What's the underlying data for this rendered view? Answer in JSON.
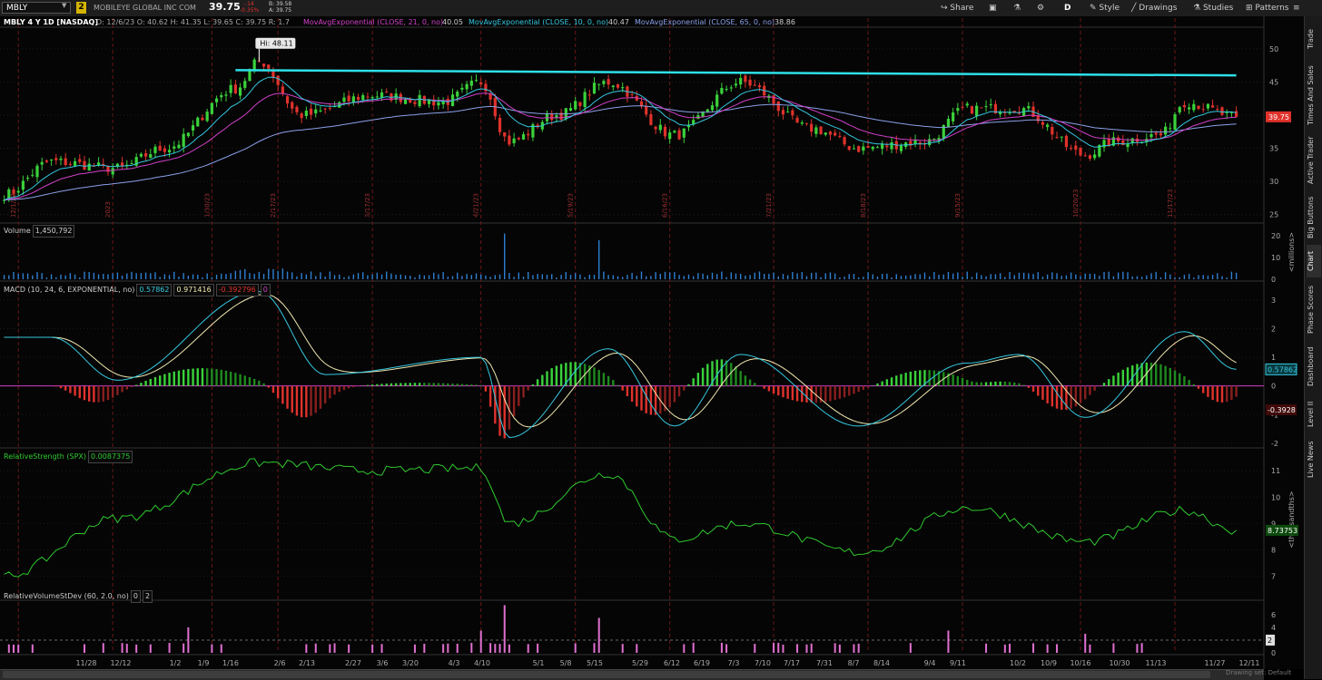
{
  "toolbar": {
    "symbol": "MBLY",
    "link_badge": "2",
    "company": "MOBILEYE GLOBAL INC COM",
    "last_price": "39.75",
    "change": "-.14",
    "change_pct": "-0.35%",
    "bid": "B: 39.58",
    "ask": "A: 39.75",
    "buttons": [
      "Share",
      "D",
      "Style",
      "Drawings",
      "Studies",
      "Patterns"
    ]
  },
  "status": {
    "title": "MBLY 4 Y 1D [NASDAQ]",
    "ohlc": "D: 12/6/23   O: 40.62   H: 41.35   L: 39.65   C: 39.75   R: 1.7",
    "ma1_label": "MovAvgExponential (CLOSE, 21, 0, no)",
    "ma1_value": "40.05",
    "ma2_label": "MovAvgExponential (CLOSE, 10, 0, no)",
    "ma2_value": "40.47",
    "ma3_label": "MovAvgExponential (CLOSE, 65, 0, no)",
    "ma3_value": "38.86"
  },
  "sidebar_tabs": [
    "Trade",
    "Times And Sales",
    "Active Trader",
    "Big Buttons",
    "Chart",
    "Phase Scores",
    "Dashboard",
    "Level II",
    "Live News"
  ],
  "colors": {
    "up": "#3ad23a",
    "down": "#e0322c",
    "ema21": "#d040c8",
    "ema10": "#35c8e0",
    "ema65": "#8aa0e8",
    "resistance": "#2ee0e8",
    "macd": "#35c8e0",
    "signal": "#f0e8b0",
    "rs": "#2fc82f",
    "rvol": "#e070d0"
  },
  "price_pane": {
    "y_ticks": [
      "50",
      "45",
      "40",
      "35",
      "30",
      "25"
    ],
    "high_label": "Hi: 48.11",
    "price_badge": "39.75",
    "month_markers": [
      "12/1/22",
      "2023",
      "1/30/23",
      "2/17/23",
      "3/17/23",
      "4/21/23",
      "5/19/23",
      "6/16/23",
      "7/21/23",
      "8/18/23",
      "9/15/23",
      "10/20/23",
      "11/17/23",
      "12/22/23"
    ]
  },
  "volume_pane": {
    "label": "Volume",
    "value": "1,450,792",
    "y_ticks": [
      "20",
      "10",
      "0"
    ],
    "unit": "<millions>"
  },
  "macd_pane": {
    "label": "MACD (10, 24, 6, EXPONENTIAL, no)",
    "macd_value": "0.57862",
    "signal_value": "0.971416",
    "hist_value": "-0.392796",
    "zero_value": "0",
    "y_ticks": [
      "3",
      "2",
      "1",
      "0",
      "-1",
      "-2"
    ],
    "badge_macd": "0.57862",
    "badge_hist": "-0.3928"
  },
  "rs_pane": {
    "label": "RelativeStrength (SPX)",
    "value": "0.0087375",
    "y_ticks": [
      "11",
      "10",
      "9",
      "8",
      "7"
    ],
    "unit": "<thousandths>",
    "badge": "8.73753"
  },
  "rvol_pane": {
    "label": "RelativeVolumeStDev (60, 2.0, no)",
    "value1": "0",
    "value2": "2",
    "y_ticks": [
      "6",
      "4",
      "2",
      "0"
    ],
    "badge": "2"
  },
  "x_axis": {
    "labels": [
      "11/28",
      "12/12",
      "1/2",
      "1/9",
      "1/16",
      "2/6",
      "2/13",
      "2/27",
      "3/6",
      "3/20",
      "4/3",
      "4/10",
      "5/1",
      "5/8",
      "5/15",
      "5/29",
      "6/12",
      "6/19",
      "7/3",
      "7/10",
      "7/17",
      "7/31",
      "8/7",
      "8/14",
      "9/4",
      "9/11",
      "10/2",
      "10/9",
      "10/16",
      "10/30",
      "11/13",
      "11/27",
      "12/11"
    ],
    "footer_text": "Drawing set: Default"
  },
  "chart_data": {
    "type": "candlestick",
    "symbol": "MBLY",
    "period": "1D",
    "price_key_points": [
      {
        "date": "11/28",
        "close": 28
      },
      {
        "date": "12/12",
        "close": 33
      },
      {
        "date": "1/2",
        "close": 32
      },
      {
        "date": "1/16",
        "close": 35
      },
      {
        "date": "2/6",
        "close": 44
      },
      {
        "date": "2/13",
        "close": 48.11
      },
      {
        "date": "2/27",
        "close": 40
      },
      {
        "date": "3/20",
        "close": 43
      },
      {
        "date": "4/10",
        "close": 42
      },
      {
        "date": "4/21",
        "close": 45
      },
      {
        "date": "5/1",
        "close": 36
      },
      {
        "date": "5/15",
        "close": 40
      },
      {
        "date": "5/29",
        "close": 45
      },
      {
        "date": "6/19",
        "close": 37
      },
      {
        "date": "7/10",
        "close": 45
      },
      {
        "date": "7/31",
        "close": 38
      },
      {
        "date": "8/14",
        "close": 35
      },
      {
        "date": "9/4",
        "close": 36
      },
      {
        "date": "9/15",
        "close": 41
      },
      {
        "date": "10/2",
        "close": 41
      },
      {
        "date": "10/20",
        "close": 34
      },
      {
        "date": "10/30",
        "close": 36
      },
      {
        "date": "11/13",
        "close": 37
      },
      {
        "date": "11/20",
        "close": 42
      },
      {
        "date": "12/6",
        "close": 39.75
      }
    ],
    "resistance_line": {
      "from_date": "2/6",
      "to_date": "12/6",
      "from_price": 46.8,
      "to_price": 46.0
    },
    "ylim": [
      24,
      53
    ],
    "last": {
      "open": 40.62,
      "high": 41.35,
      "low": 39.65,
      "close": 39.75
    },
    "ema_last": {
      "ema21": 40.05,
      "ema10": 40.47,
      "ema65": 38.86
    },
    "volume_spikes_millions": [
      {
        "date": "4/28",
        "value": 21
      },
      {
        "date": "5/26",
        "value": 18
      }
    ],
    "macd_key_points": [
      {
        "date": "12/12",
        "macd": 1.7
      },
      {
        "date": "1/2",
        "macd": 0.2
      },
      {
        "date": "2/13",
        "macd": 3.3
      },
      {
        "date": "3/6",
        "macd": 0.4
      },
      {
        "date": "4/21",
        "macd": 1.0
      },
      {
        "date": "5/1",
        "macd": -1.8
      },
      {
        "date": "5/29",
        "macd": 1.3
      },
      {
        "date": "6/19",
        "macd": -1.4
      },
      {
        "date": "7/10",
        "macd": 1.1
      },
      {
        "date": "8/14",
        "macd": -1.4
      },
      {
        "date": "9/15",
        "macd": 0.8
      },
      {
        "date": "10/2",
        "macd": 1.1
      },
      {
        "date": "10/20",
        "macd": -1.1
      },
      {
        "date": "11/20",
        "macd": 1.9
      },
      {
        "date": "12/6",
        "macd": 0.58
      }
    ],
    "rs_key_points": [
      {
        "date": "11/28",
        "rs": 7.0
      },
      {
        "date": "1/2",
        "rs": 9.2
      },
      {
        "date": "2/13",
        "rs": 11.3
      },
      {
        "date": "3/20",
        "rs": 11.0
      },
      {
        "date": "4/21",
        "rs": 11.1
      },
      {
        "date": "5/1",
        "rs": 9.0
      },
      {
        "date": "5/29",
        "rs": 10.9
      },
      {
        "date": "6/19",
        "rs": 8.4
      },
      {
        "date": "7/10",
        "rs": 9.0
      },
      {
        "date": "8/14",
        "rs": 7.9
      },
      {
        "date": "9/15",
        "rs": 9.6
      },
      {
        "date": "10/20",
        "rs": 8.3
      },
      {
        "date": "11/20",
        "rs": 9.5
      },
      {
        "date": "12/6",
        "rs": 8.74
      }
    ],
    "rvol_spikes": [
      {
        "date": "1/23",
        "value": 4
      },
      {
        "date": "4/21",
        "value": 3.5
      },
      {
        "date": "4/28",
        "value": 7.5
      },
      {
        "date": "5/26",
        "value": 5.5
      },
      {
        "date": "9/11",
        "value": 3.5
      },
      {
        "date": "10/20",
        "value": 3
      }
    ]
  }
}
